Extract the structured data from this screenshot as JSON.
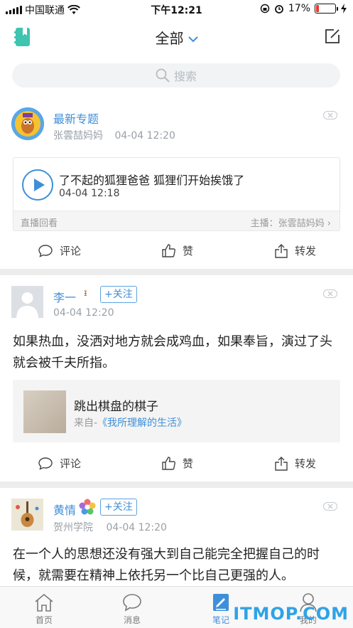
{
  "status_bar": {
    "carrier": "中国联通",
    "time": "下午12:21",
    "battery": "17%",
    "battery_level": 0.17,
    "battery_color": "#e53935"
  },
  "nav": {
    "title": "全部",
    "left_icon": "notebook-icon",
    "right_icon": "compose-icon"
  },
  "search": {
    "placeholder": "搜索"
  },
  "posts": [
    {
      "name": "最新专题",
      "author": "张雲喆妈妈",
      "time": "04-04 12:20",
      "live": {
        "title": "了不起的狐狸爸爸 狐狸们开始挨饿了",
        "time": "04-04 12:18",
        "tag": "直播回看",
        "host": "主播：张雲喆妈妈"
      }
    },
    {
      "name": "李一",
      "badge": "ᵻ",
      "follow": "+关注",
      "time": "04-04 12:20",
      "content": "如果热血，没洒对地方就会成鸡血，如果奉旨，演过了头就会被千夫所指。",
      "quote": {
        "title": "跳出棋盘的棋子",
        "from_prefix": "来自-",
        "from_link": "《我所理解的生活》"
      }
    },
    {
      "name": "黄情",
      "follow": "+关注",
      "school": "贺州学院",
      "time": "04-04 12:20",
      "content": "在一个人的思想还没有强大到自己能完全把握自己的时候，就需要在精神上依托另一个比自己更强的人。"
    }
  ],
  "actions": {
    "comment": "评论",
    "like": "赞",
    "share": "转发"
  },
  "tabs": [
    {
      "label": "首页",
      "icon": "home-icon"
    },
    {
      "label": "消息",
      "icon": "message-icon"
    },
    {
      "label": "笔记",
      "icon": "note-icon",
      "active": true
    },
    {
      "label": "我的",
      "icon": "profile-icon"
    }
  ],
  "watermark": "ITMOP.COM",
  "colors": {
    "accent": "#3f8fd8",
    "teal": "#3ec4b0"
  }
}
